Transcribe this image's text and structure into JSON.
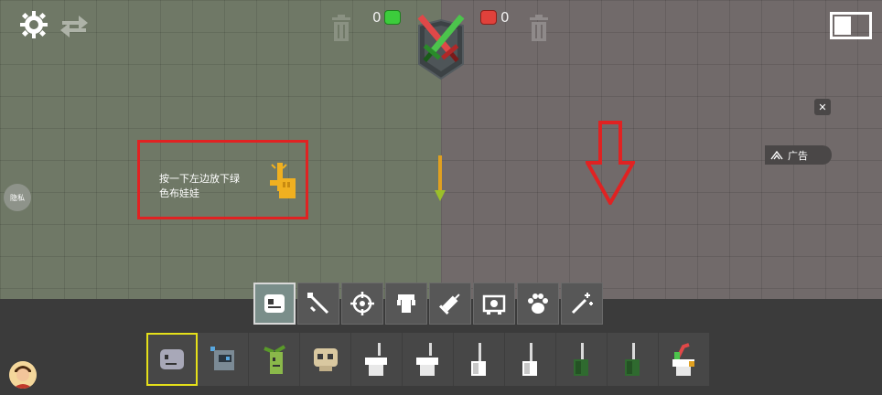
{
  "hud": {
    "green_score": "0",
    "red_score": "0"
  },
  "hint": {
    "text_line1": "按一下左边放下绿",
    "text_line2": "色布娃娃"
  },
  "ad": {
    "label": "广告",
    "close": "✕"
  },
  "privacy": {
    "label": "隐私"
  },
  "categories": [
    {
      "name": "ragdolls",
      "icon": "ragdoll-icon",
      "active": true
    },
    {
      "name": "melee",
      "icon": "sword-icon",
      "active": false
    },
    {
      "name": "firearms",
      "icon": "crosshair-icon",
      "active": false
    },
    {
      "name": "explosives",
      "icon": "bomb-icon",
      "active": false
    },
    {
      "name": "syringes",
      "icon": "syringe-icon",
      "active": false
    },
    {
      "name": "machinery",
      "icon": "machine-icon",
      "active": false
    },
    {
      "name": "animals",
      "icon": "paw-icon",
      "active": false
    },
    {
      "name": "magic",
      "icon": "wand-icon",
      "active": false
    }
  ],
  "items": [
    {
      "name": "gray-ragdoll",
      "selected": true
    },
    {
      "name": "robot-ragdoll",
      "selected": false
    },
    {
      "name": "plant-ragdoll",
      "selected": false
    },
    {
      "name": "skull-ragdoll",
      "selected": false
    },
    {
      "name": "toilet-1",
      "selected": false
    },
    {
      "name": "toilet-2",
      "selected": false
    },
    {
      "name": "toilet-3",
      "selected": false
    },
    {
      "name": "toilet-4",
      "selected": false
    },
    {
      "name": "green-toilet-1",
      "selected": false
    },
    {
      "name": "green-toilet-2",
      "selected": false
    },
    {
      "name": "colorful-toilet",
      "selected": false
    }
  ],
  "colors": {
    "green_side": "#6f7866",
    "red_side": "#716a6a",
    "hint_border": "#e02222",
    "selected_border": "#e5e01a"
  }
}
